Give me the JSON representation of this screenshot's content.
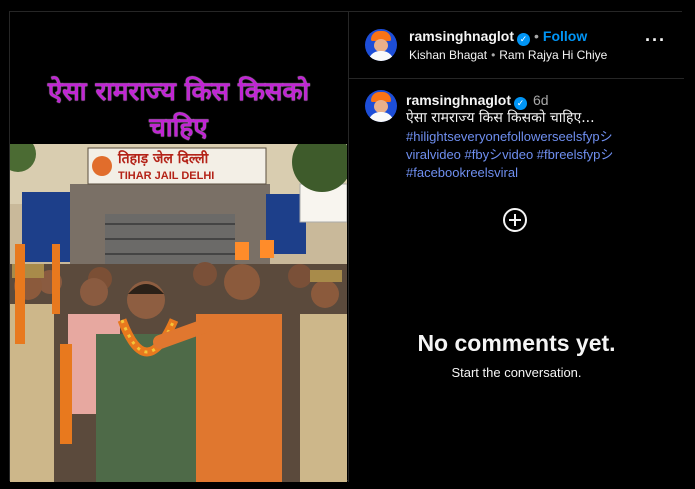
{
  "post": {
    "image_headline_line1": "ऐसा रामराज्य किस किसको",
    "image_headline_line2": "चाहिए",
    "sign_hindi": "तिहाड़ जेल दिल्ली",
    "sign_english": "TIHAR JAIL DELHI"
  },
  "header": {
    "username": "ramsinghnaglot",
    "separator": "•",
    "follow_label": "Follow",
    "audio_artist": "Kishan Bhagat",
    "audio_separator": "•",
    "audio_title": "Ram Rajya Hi Chiye",
    "more_label": "···"
  },
  "caption": {
    "username": "ramsinghnaglot",
    "age": "6d",
    "text": "ऐसा रामराज्य किस किसको चाहिए...",
    "hashtags": "#hilightseveryonefollowerseelsfypシviralvideo #fbyシvideo #fbreelsfypシ #facebookreelsviral"
  },
  "comments": {
    "empty_title": "No comments yet.",
    "empty_subtitle": "Start the conversation."
  },
  "colors": {
    "accent": "#0095f6",
    "hashtag": "#6f8ff0",
    "headline": "#c026d3"
  }
}
